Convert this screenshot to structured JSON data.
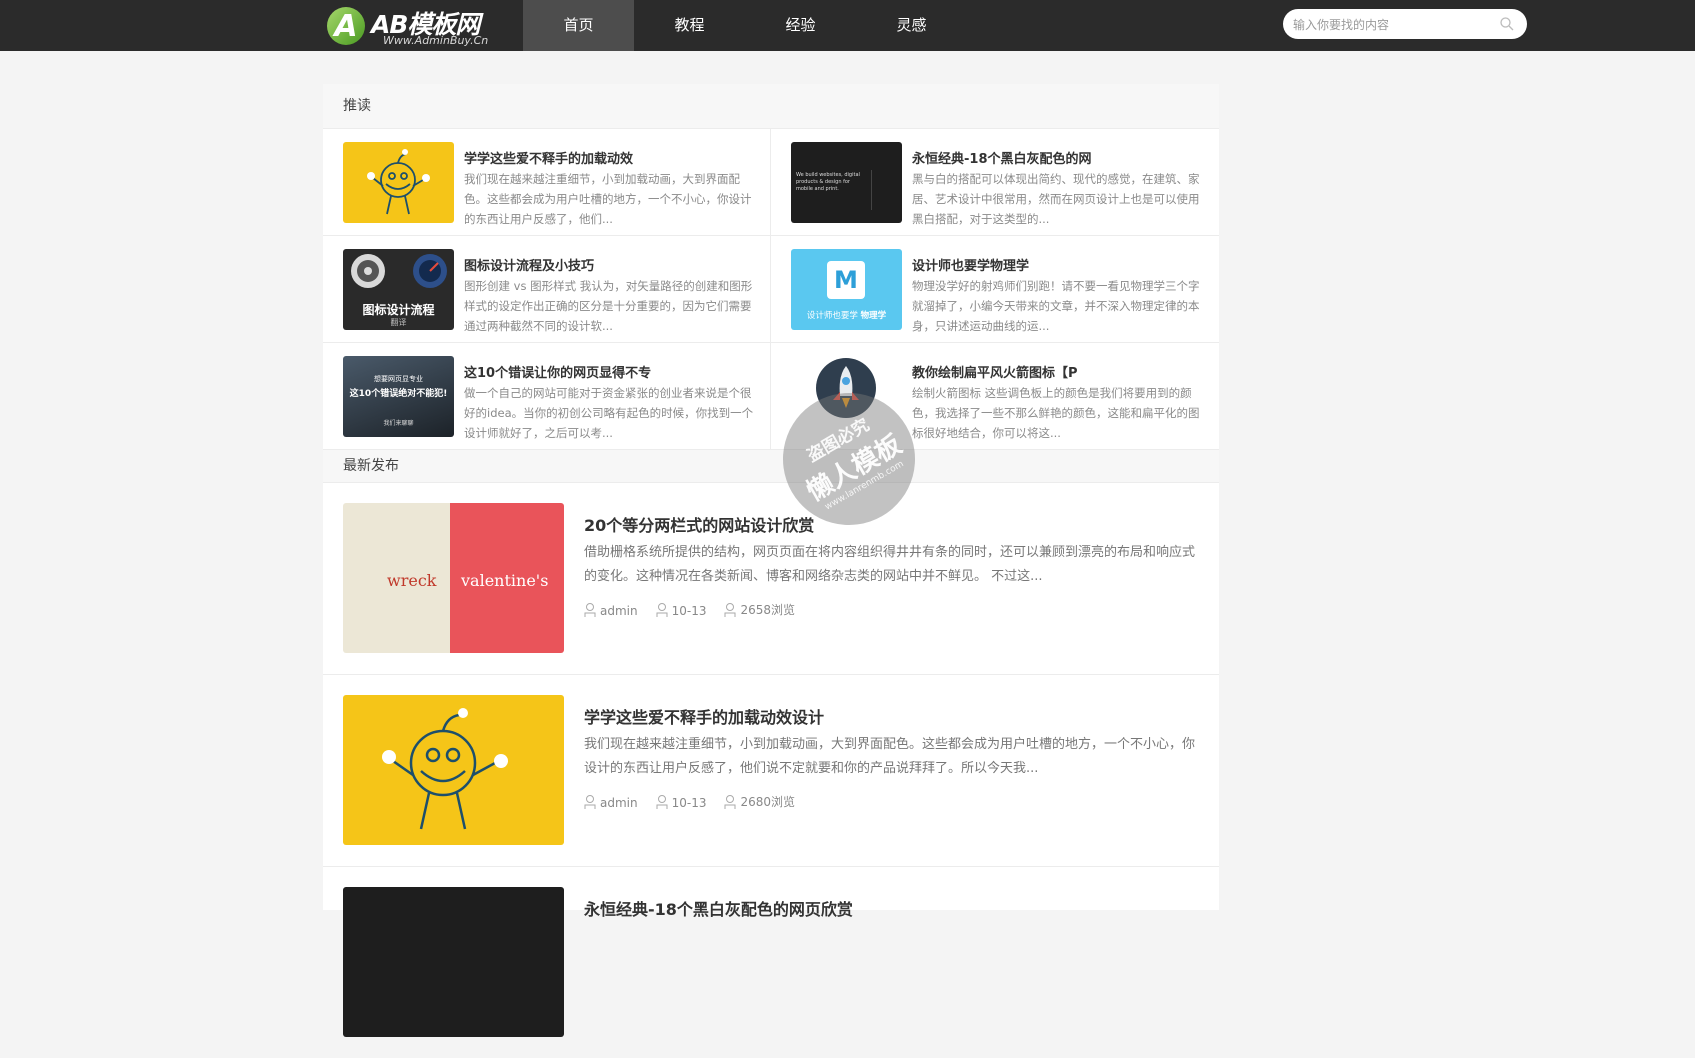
{
  "header": {
    "logo_text": "AB模板网",
    "logo_letter": "A",
    "logo_sub": "Www.AdminBuy.Cn",
    "nav": [
      {
        "label": "首页",
        "active": true
      },
      {
        "label": "教程",
        "active": false
      },
      {
        "label": "经验",
        "active": false
      },
      {
        "label": "灵感",
        "active": false
      }
    ],
    "search": {
      "placeholder": "输入你要找的内容",
      "icon": "search-icon"
    }
  },
  "recommend": {
    "heading": "推读",
    "items": [
      {
        "title": "学学这些爱不释手的加载动效",
        "desc": "我们现在越来越注重细节，小到加载动画，大到界面配色。这些都会成为用户吐槽的地方，一个不小心，你设计的东西让用户反感了，他们...",
        "thumb": "yellow-juggler"
      },
      {
        "title": "永恒经典-18个黑白灰配色的网",
        "desc": "黑与白的搭配可以体现出简约、现代的感觉，在建筑、家居、艺术设计中很常用，然而在网页设计上也是可以使用黑白搭配，对于这类型的...",
        "thumb": "dark-site",
        "thumb_text": "We build websites, digital products & design for mobile and print."
      },
      {
        "title": "图标设计流程及小技巧",
        "desc": "图形创建 vs 图形样式 我认为，对矢量路径的创建和图形样式的设定作出正确的区分是十分重要的，因为它们需要通过两种截然不同的设计软...",
        "thumb": "icon-design",
        "thumb_text": "图标设计流程",
        "thumb_sub": "翻译"
      },
      {
        "title": "设计师也要学物理学",
        "desc": "物理没学好的射鸡师们别跑！请不要一看见物理学三个字就溜掉了，小编今天带来的文章，并不深入物理定律的本身，只讲述运动曲线的运...",
        "thumb": "physics",
        "thumb_text": "设计师也要学",
        "thumb_bold": "物理学",
        "thumb_letter": "M"
      },
      {
        "title": "这10个错误让你的网页显得不专",
        "desc": "做一个自己的网站可能对于资金紧张的创业者来说是个很好的idea。当你的初创公司略有起色的时候，你找到一个设计师就好了，之后可以考...",
        "thumb": "errors",
        "thumb_text": "这10个错误绝对不能犯!",
        "thumb_top": "想要网页显专业",
        "thumb_bottom": "我们来聊聊"
      },
      {
        "title": "教你绘制扁平风火箭图标【P",
        "desc": "绘制火箭图标 这些调色板上的颜色是我们将要用到的颜色，我选择了一些不那么鲜艳的颜色，这能和扁平化的图标很好地结合，你可以将这...",
        "thumb": "rocket"
      }
    ]
  },
  "latest": {
    "heading": "最新发布",
    "posts": [
      {
        "title": "20个等分两栏式的网站设计欣赏",
        "desc": "借助栅格系统所提供的结构，网页页面在将内容组织得井井有条的同时，还可以兼顾到漂亮的布局和响应式的变化。这种情况在各类新闻、博客和网络杂志类的网站中并不鲜见。 不过这...",
        "author": "admin",
        "date": "10-13",
        "views": "2658浏览",
        "thumb": "wreck-valentine",
        "thumb_left": "wreck",
        "thumb_right": "valentine's"
      },
      {
        "title": "学学这些爱不释手的加载动效设计",
        "desc": "我们现在越来越注重细节，小到加载动画，大到界面配色。这些都会成为用户吐槽的地方，一个不小心，你设计的东西让用户反感了，他们说不定就要和你的产品说拜拜了。所以今天我...",
        "author": "admin",
        "date": "10-13",
        "views": "2680浏览",
        "thumb": "yellow-juggler"
      },
      {
        "title": "永恒经典-18个黑白灰配色的网页欣赏",
        "desc": "",
        "author": "",
        "date": "",
        "views": "",
        "thumb": "dark-site"
      }
    ]
  },
  "watermark": {
    "line1": "盗图必究",
    "line2": "懒人模板",
    "line3": "www.lanrenmb.com"
  },
  "colors": {
    "topbar": "#2b2b2b",
    "active_nav": "#4d4d4d",
    "yellow": "#f5c518",
    "cyan": "#5ac8f0",
    "red": "#e9545a"
  }
}
